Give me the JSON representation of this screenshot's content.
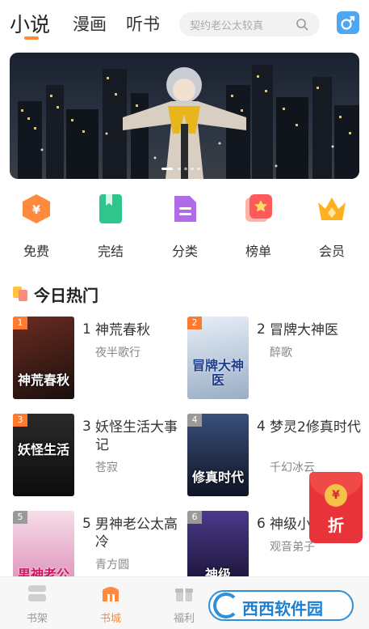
{
  "header": {
    "tabs": [
      {
        "label": "小说"
      },
      {
        "label": "漫画"
      },
      {
        "label": "听书"
      }
    ],
    "search_placeholder": "契约老公太较真"
  },
  "categories": [
    {
      "label": "免费",
      "icon": "yen-hexagon-icon",
      "color": "#ff8a3d"
    },
    {
      "label": "完结",
      "icon": "green-book-icon",
      "color": "#2fc58c"
    },
    {
      "label": "分类",
      "icon": "document-icon",
      "color": "#b06be8"
    },
    {
      "label": "榜单",
      "icon": "ranking-badge-icon",
      "color": "#ff5a5a"
    },
    {
      "label": "会员",
      "icon": "crown-icon",
      "color": "#ffb020"
    }
  ],
  "section": {
    "title": "今日热门"
  },
  "books": [
    {
      "rank": "1",
      "num": "1",
      "title": "神荒春秋",
      "author": "夜半歌行",
      "cover_text": "神荒春秋",
      "rank_color": "#ff7a2e",
      "cover_color": "#3a1e1a"
    },
    {
      "rank": "2",
      "num": "2",
      "title": "冒牌大神医",
      "author": "醉歌",
      "cover_text": "冒牌大神医",
      "rank_color": "#ff7a2e",
      "cover_color": "#cfd9e6"
    },
    {
      "rank": "3",
      "num": "3",
      "title": "妖怪生活大事记",
      "author": "苍寂",
      "cover_text": "妖怪生活",
      "rank_color": "#ff7a2e",
      "cover_color": "#1c1c1c"
    },
    {
      "rank": "4",
      "num": "4",
      "title": "梦灵2修真时代",
      "author": "千幻冰云",
      "cover_text": "修真时代",
      "rank_color": "#9a9a9a",
      "cover_color": "#1f2a44"
    },
    {
      "rank": "5",
      "num": "5",
      "title": "男神老公太高冷",
      "author": "青方圆",
      "cover_text": "男神老公",
      "rank_color": "#9a9a9a",
      "cover_color": "#f1c8dc"
    },
    {
      "rank": "6",
      "num": "6",
      "title": "神级小",
      "author": "观音弟子",
      "cover_text": "神级",
      "rank_color": "#9a9a9a",
      "cover_color": "#2c2450"
    }
  ],
  "red_packet": {
    "label": "折",
    "coin": "¥"
  },
  "bottom_nav": [
    {
      "label": "书架",
      "active": false
    },
    {
      "label": "书城",
      "active": true
    },
    {
      "label": "福利",
      "active": false
    }
  ],
  "watermark": {
    "text": "西西软件园"
  }
}
